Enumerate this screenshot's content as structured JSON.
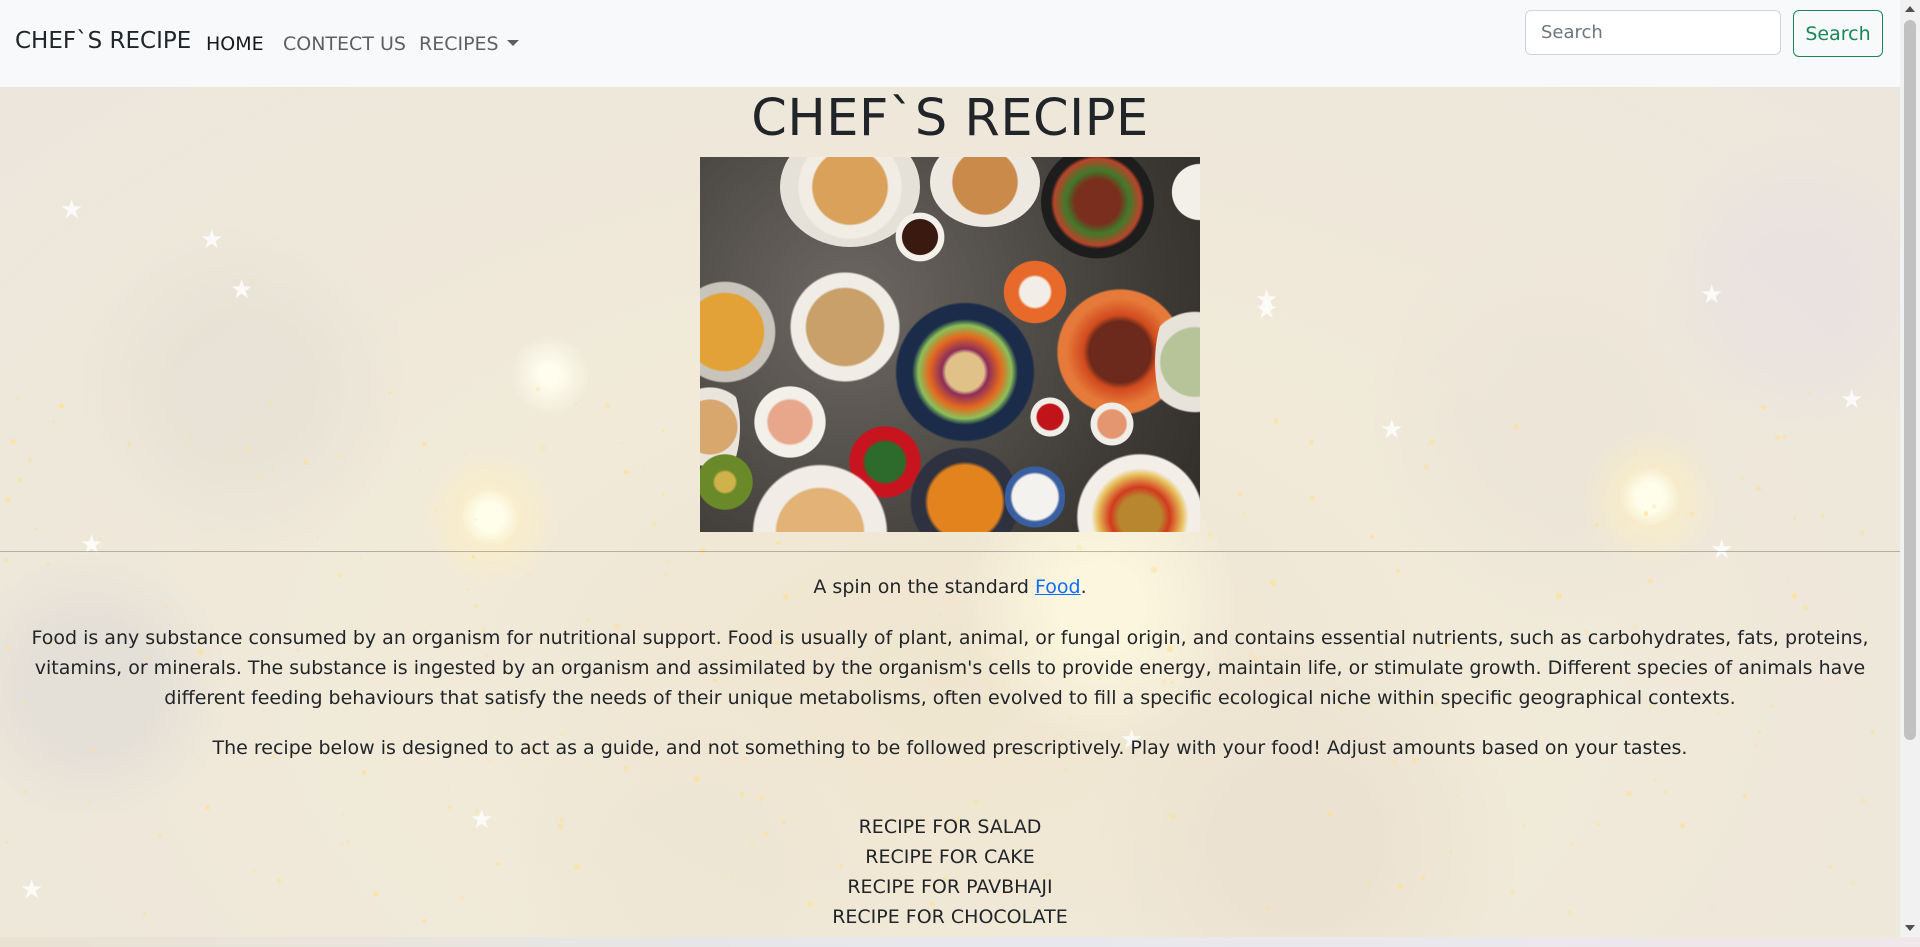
{
  "navbar": {
    "brand": "CHEF`S RECIPE",
    "links": [
      "HOME",
      "CONTECT US",
      "RECIPES"
    ],
    "search": {
      "placeholder": "Search",
      "button_label": "Search"
    }
  },
  "main": {
    "title": "CHEF`S RECIPE",
    "tagline_prefix": "A spin on the standard ",
    "tagline_link": "Food",
    "tagline_suffix": ".",
    "paragraph_1": "Food is any substance consumed by an organism for nutritional support. Food is usually of plant, animal, or fungal origin, and contains essential nutrients, such as carbohydrates, fats, proteins, vitamins, or minerals. The substance is ingested by an organism and assimilated by the organism's cells to provide energy, maintain life, or stimulate growth. Different species of animals have different feeding behaviours that satisfy the needs of their unique metabolisms, often evolved to fill a specific ecological niche within specific geographical contexts.",
    "paragraph_2": "The recipe below is designed to act as a guide, and not something to be followed prescriptively. Play with your food! Adjust amounts based on your tastes.",
    "recipes": [
      "RECIPE FOR SALAD",
      "RECIPE FOR CAKE",
      "RECIPE FOR PAVBHAJI",
      "RECIPE FOR CHOCOLATE"
    ]
  },
  "colors": {
    "accent": "#198754",
    "link": "#0d6efd",
    "navbar_bg": "#f8f9fa"
  }
}
